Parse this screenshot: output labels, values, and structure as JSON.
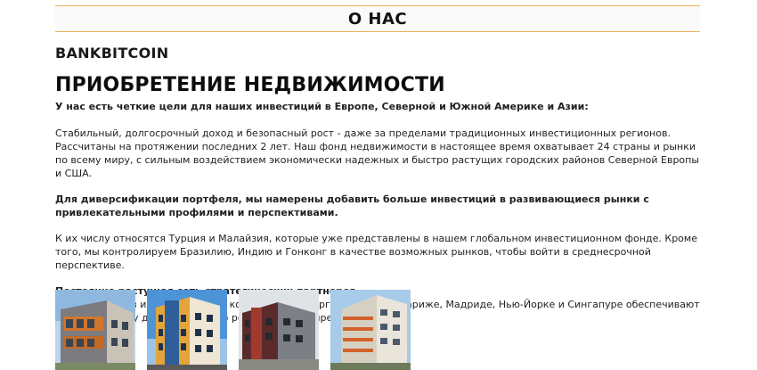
{
  "header": {
    "title": "О НАС"
  },
  "brand": "BANKBITCOIN",
  "section": {
    "heading": "ПРИОБРЕТЕНИЕ НЕДВИЖИМОСТИ",
    "intro": "У нас есть четкие цели для наших инвестиций в Европе, Северной и Южной Америке и Азии:",
    "p1": "Стабильный, долгосрочный доход и безопасный рост - даже за пределами традиционных инвестиционных регионов. Рассчитаны на протяжении последних 2 лет. Наш фонд недвижимости в настоящее время охватывает 24 страны и рынки по всему миру, с сильным воздействием экономически надежных и быстро растущих городских районов Северной Европы и США.",
    "p2": "Для диверсификации портфеля, мы намерены добавить больше инвестиций в развивающиеся рынки с привлекательными профилями и перспективами.",
    "p3": "К их числу относятся Турция и Малайзия, которые уже представлены в нашем глобальном инвестиционном фонде. Кроме того, мы контролируем Бразилию, Индию и Гонконг в качестве возможных рынков, чтобы войти в среднесрочной перспективе.",
    "p4_title": "Постоянно растущая сеть стратегических партнеров",
    "p4_body": "и сильный союз инвестиционной команды в Гамбурге и офисах в Париже, Мадриде, Нью-Йорке и Сингапуре обеспечивают прочную основу для безопасного роста во всем мире."
  },
  "gallery": [
    "building-photo-1",
    "building-photo-2",
    "building-photo-3",
    "building-photo-4"
  ]
}
